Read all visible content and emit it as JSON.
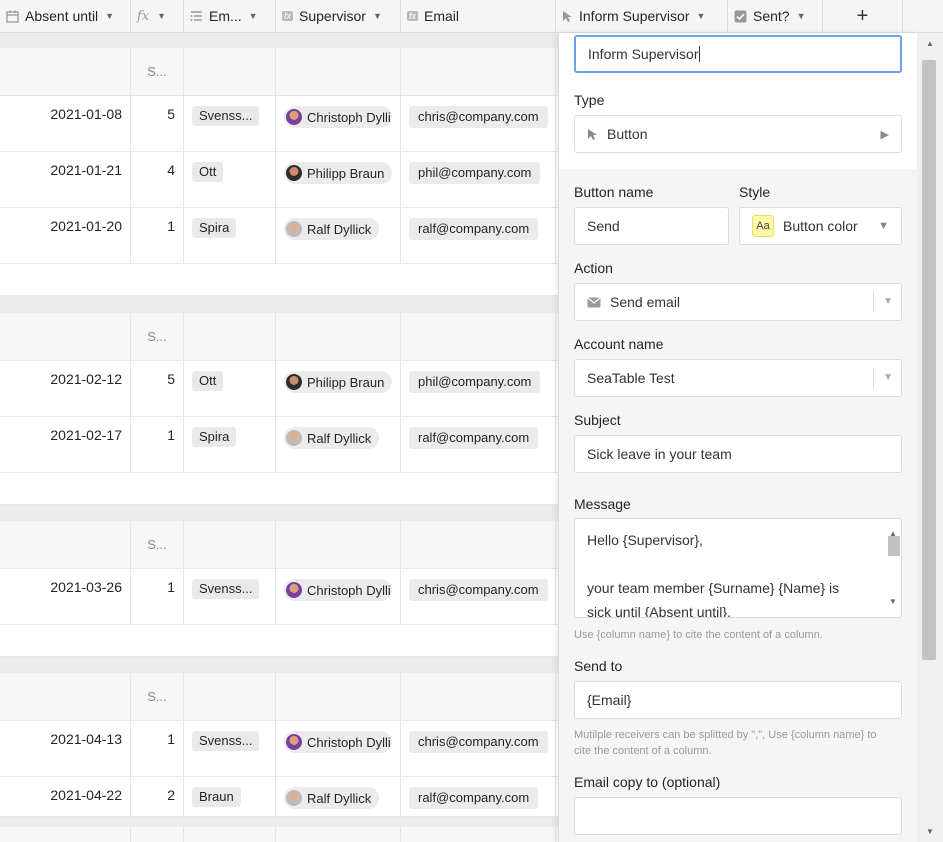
{
  "header": {
    "columns": [
      {
        "label": "Absent until",
        "icon": "calendar-icon"
      },
      {
        "label": "",
        "icon": "formula-icon"
      },
      {
        "label": "Em...",
        "icon": "list-icon"
      },
      {
        "label": "Supervisor",
        "icon": "formula-icon"
      },
      {
        "label": "Email",
        "icon": "formula-icon"
      },
      {
        "label": "Inform Supervisor",
        "icon": "cursor-icon"
      },
      {
        "label": "Sent?",
        "icon": "checkbox-icon"
      }
    ],
    "add_label": "+"
  },
  "group_label": "S...",
  "group_partial": "S",
  "rows": [
    {
      "date": "2021-01-08",
      "num": "5",
      "tag": "Svenss...",
      "supervisor": "Christoph Dylli",
      "avatar": "c",
      "email": "chris@company.com"
    },
    {
      "date": "2021-01-21",
      "num": "4",
      "tag": "Ott",
      "supervisor": "Philipp Braun",
      "avatar": "p",
      "email": "phil@company.com"
    },
    {
      "date": "2021-01-20",
      "num": "1",
      "tag": "Spira",
      "supervisor": "Ralf Dyllick",
      "avatar": "r",
      "email": "ralf@company.com"
    },
    {
      "date": "2021-02-12",
      "num": "5",
      "tag": "Ott",
      "supervisor": "Philipp Braun",
      "avatar": "p",
      "email": "phil@company.com"
    },
    {
      "date": "2021-02-17",
      "num": "1",
      "tag": "Spira",
      "supervisor": "Ralf Dyllick",
      "avatar": "r",
      "email": "ralf@company.com"
    },
    {
      "date": "2021-03-26",
      "num": "1",
      "tag": "Svenss...",
      "supervisor": "Christoph Dylli",
      "avatar": "c",
      "email": "chris@company.com"
    },
    {
      "date": "2021-04-13",
      "num": "1",
      "tag": "Svenss...",
      "supervisor": "Christoph Dylli",
      "avatar": "c",
      "email": "chris@company.com"
    },
    {
      "date": "2021-04-22",
      "num": "2",
      "tag": "Braun",
      "supervisor": "Ralf Dyllick",
      "avatar": "r",
      "email": "ralf@company.com"
    }
  ],
  "panel": {
    "column_name": "Inform Supervisor",
    "type_label": "Type",
    "type_value": "Button",
    "button_name_label": "Button name",
    "button_name_value": "Send",
    "style_label": "Style",
    "style_badge": "Aa",
    "style_value": "Button color",
    "action_label": "Action",
    "action_value": "Send email",
    "account_label": "Account name",
    "account_value": "SeaTable Test",
    "subject_label": "Subject",
    "subject_value": "Sick leave in your team",
    "message_label": "Message",
    "message_lines": [
      "Hello {Supervisor},",
      "",
      "your team member {Surname} {Name} is",
      "sick until {Absent until}."
    ],
    "message_hint": "Use {column name} to cite the content of a column.",
    "send_to_label": "Send to",
    "send_to_value": "{Email}",
    "send_to_hint": "Mutilple receivers can be splitted by \",\", Use {column name} to cite the content of a column.",
    "copy_label": "Email copy to (optional)",
    "copy_value": ""
  },
  "colors": {
    "focus": "#6ea1e6",
    "style_badge": "#fff6a8"
  }
}
